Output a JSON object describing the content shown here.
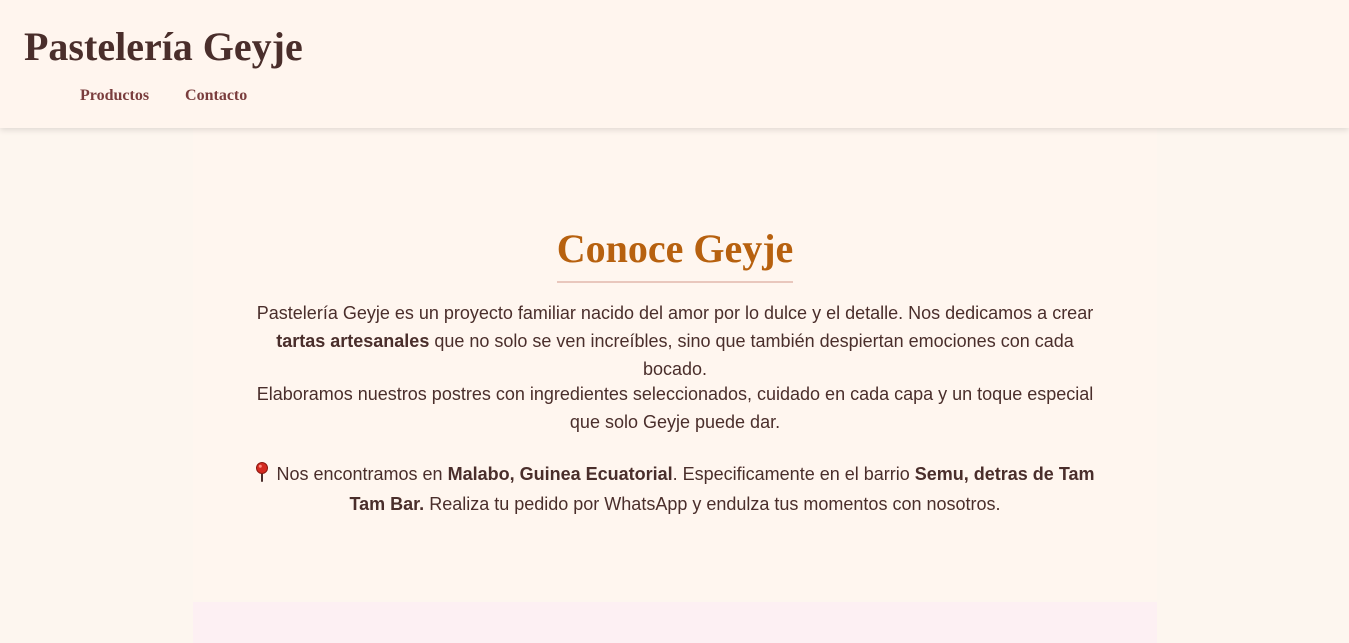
{
  "header": {
    "brand": "Pastelería Geyje",
    "nav": [
      {
        "label": "Productos"
      },
      {
        "label": "Contacto"
      }
    ]
  },
  "about": {
    "title": "Conoce Geyje",
    "p1": {
      "text_before": "Pastelería Geyje es un proyecto familiar nacido del amor por lo dulce y el detalle. Nos dedicamos a crear ",
      "bold": "tartas artesanales",
      "text_after": " que no solo se ven increíbles, sino que también despiertan emociones con cada bocado."
    },
    "p2": {
      "text": "Elaboramos nuestros postres con ingredientes seleccionados, cuidado en cada capa y un toque especial que solo Geyje puede dar."
    },
    "p3": {
      "icon": "location-pin-icon",
      "text1": " Nos encontramos en ",
      "bold1": "Malabo, Guinea Ecuatorial",
      "text2": ". Especificamente en el barrio ",
      "bold2": "Semu, detras de Tam Tam Bar.",
      "text3": " Realiza tu pedido por WhatsApp y endulza tus momentos con nosotros."
    }
  },
  "colors": {
    "page_bg": "#fdf6ef",
    "header_bg": "#fff5ee",
    "text": "#4a2e2b",
    "nav_link": "#7a3d3d",
    "title_accent": "#b7610f",
    "title_underline": "#e9c7bd",
    "next_section_bg": "#fdf0f3"
  }
}
